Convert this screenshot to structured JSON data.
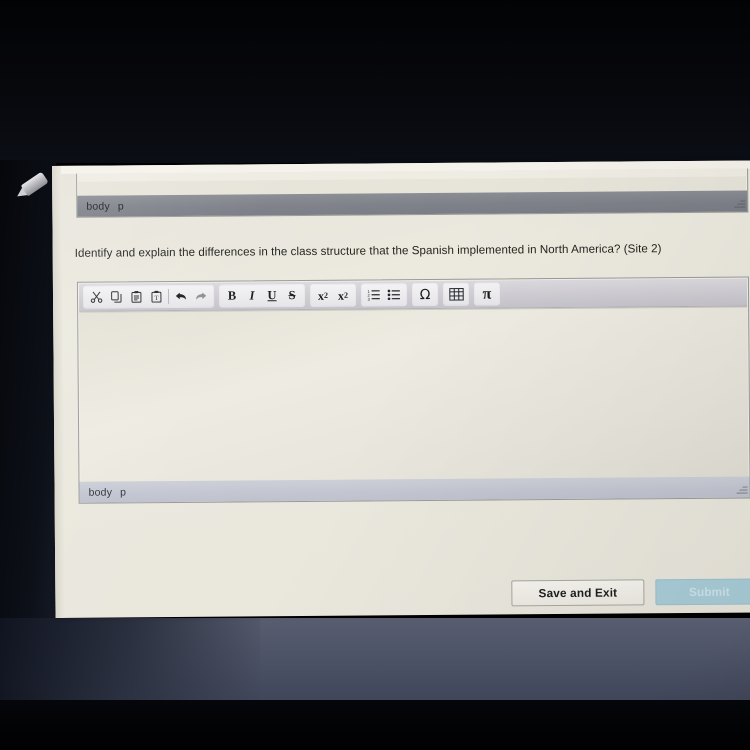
{
  "environment": {
    "device_note": "photo-of-laptop-screen",
    "stylus_icon": "pencil-icon",
    "bezel_color": "#07080c",
    "desk_color": "#4d5366"
  },
  "upper_editor": {
    "statusbar": {
      "elements_path": [
        "body",
        "p"
      ]
    },
    "resize_handle_icon": "resize-grip-icon"
  },
  "question": {
    "text": "Identify and explain the differences in the class structure that the Spanish implemented in North America? (Site 2)"
  },
  "main_editor": {
    "toolbar": {
      "groups": [
        {
          "name": "clipboard-and-history",
          "buttons": [
            {
              "icon": "cut-scissors-icon",
              "label": "Cut"
            },
            {
              "icon": "copy-icon",
              "label": "Copy"
            },
            {
              "icon": "paste-icon",
              "label": "Paste"
            },
            {
              "icon": "paste-as-text-icon",
              "label": "Paste as plain text"
            },
            {
              "icon": "undo-arrow-icon",
              "label": "Undo"
            },
            {
              "icon": "redo-arrow-icon",
              "label": "Redo"
            }
          ]
        },
        {
          "name": "text-styles",
          "buttons": [
            {
              "icon": "bold-icon",
              "label": "B"
            },
            {
              "icon": "italic-icon",
              "label": "I"
            },
            {
              "icon": "underline-icon",
              "label": "U"
            },
            {
              "icon": "strikethrough-icon",
              "label": "S"
            }
          ]
        },
        {
          "name": "script",
          "buttons": [
            {
              "icon": "subscript-icon",
              "label": "x",
              "script": "2"
            },
            {
              "icon": "superscript-icon",
              "label": "x",
              "script": "2"
            }
          ]
        },
        {
          "name": "lists",
          "buttons": [
            {
              "icon": "numbered-list-icon",
              "label": "Insert/Remove Numbered List"
            },
            {
              "icon": "bulleted-list-icon",
              "label": "Insert/Remove Bulleted List"
            }
          ]
        },
        {
          "name": "special-character",
          "buttons": [
            {
              "icon": "omega-icon",
              "label": "Ω"
            }
          ]
        },
        {
          "name": "table",
          "buttons": [
            {
              "icon": "table-icon",
              "label": "Table"
            }
          ]
        },
        {
          "name": "math",
          "buttons": [
            {
              "icon": "pi-icon",
              "label": "π"
            }
          ]
        }
      ]
    },
    "canvas": {
      "value": "",
      "placeholder": "",
      "caret_visible": true
    },
    "statusbar": {
      "elements_path": [
        "body",
        "p"
      ]
    },
    "resize_handle_icon": "resize-grip-icon"
  },
  "footer": {
    "save_label": "Save and Exit",
    "submit_label": "Submit",
    "submit_disabled": true,
    "submit_bg": "#a9cdd8",
    "submit_text_color": "#cfe3ea"
  }
}
